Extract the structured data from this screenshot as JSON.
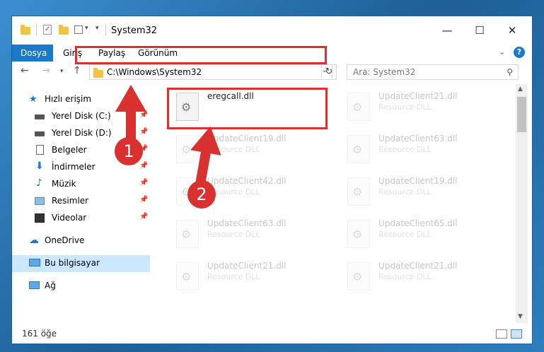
{
  "window": {
    "title": "System32"
  },
  "ribbon": {
    "tabs": [
      "Dosya",
      "Giriş",
      "Paylaş",
      "Görünüm"
    ]
  },
  "address": {
    "path": "C:\\Windows\\System32",
    "search_placeholder": "Ara: System32"
  },
  "nav": {
    "items": [
      {
        "label": "Hızlı erişim",
        "icon": "star-icon"
      },
      {
        "label": "Yerel Disk (C:)",
        "icon": "drive-icon",
        "pinned": true
      },
      {
        "label": "Yerel Disk (D:)",
        "icon": "drive-icon",
        "pinned": true
      },
      {
        "label": "Belgeler",
        "icon": "documents-icon",
        "pinned": true
      },
      {
        "label": "İndirmeler",
        "icon": "download-icon",
        "pinned": true
      },
      {
        "label": "Müzik",
        "icon": "music-icon",
        "pinned": true
      },
      {
        "label": "Resimler",
        "icon": "pictures-icon",
        "pinned": true
      },
      {
        "label": "Videolar",
        "icon": "videos-icon",
        "pinned": true
      },
      {
        "label": "OneDrive",
        "icon": "cloud-icon"
      },
      {
        "label": "Bu bilgisayar",
        "icon": "computer-icon",
        "selected": true
      },
      {
        "label": "Ağ",
        "icon": "network-icon"
      }
    ]
  },
  "files": [
    {
      "name": "eregcall.dll",
      "type": ""
    },
    {
      "name": "UpdateClient21.dll",
      "type": "Resource DLL"
    },
    {
      "name": "UpdateClient19.dll",
      "type": "Resource DLL"
    },
    {
      "name": "UpdateClient63.dll",
      "type": "Resource DLL"
    },
    {
      "name": "UpdateClient42.dll",
      "type": "Resource DLL"
    },
    {
      "name": "UpdateClient19.dll",
      "type": "Resource DLL"
    },
    {
      "name": "UpdateClient63.dll",
      "type": "Resource DLL"
    },
    {
      "name": "UpdateClient65.dll",
      "type": "Resource DLL"
    },
    {
      "name": "UpdateClient21.dll",
      "type": "Resource DLL"
    },
    {
      "name": "UpdateClient21.dll",
      "type": "Resource DLL"
    }
  ],
  "status": {
    "count": "161 öğe"
  },
  "callouts": {
    "one": "1",
    "two": "2"
  },
  "colors": {
    "accent": "#1979ca",
    "highlight": "#d93030",
    "selected_bg": "#cce8ff"
  }
}
